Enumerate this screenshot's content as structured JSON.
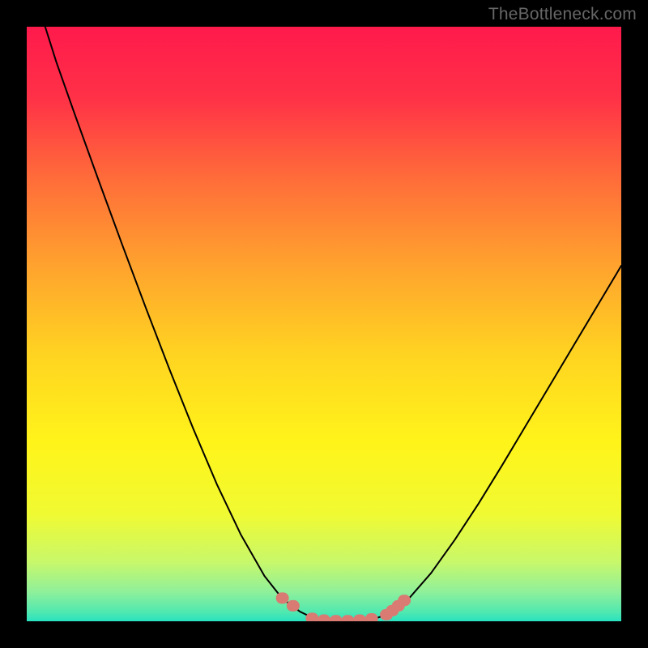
{
  "watermark": "TheBottleneck.com",
  "chart_data": {
    "type": "line",
    "title": "",
    "xlabel": "",
    "ylabel": "",
    "xlim": [
      0,
      100
    ],
    "ylim": [
      0,
      100
    ],
    "grid": false,
    "legend": false,
    "background_gradient": {
      "stops": [
        {
          "offset": 0.0,
          "color": "#ff1a4c"
        },
        {
          "offset": 0.12,
          "color": "#ff3147"
        },
        {
          "offset": 0.25,
          "color": "#ff6a3a"
        },
        {
          "offset": 0.4,
          "color": "#ffa22e"
        },
        {
          "offset": 0.55,
          "color": "#ffd321"
        },
        {
          "offset": 0.7,
          "color": "#fff41a"
        },
        {
          "offset": 0.82,
          "color": "#f0fa32"
        },
        {
          "offset": 0.9,
          "color": "#c8f86a"
        },
        {
          "offset": 0.95,
          "color": "#90f09a"
        },
        {
          "offset": 0.985,
          "color": "#4fe8b0"
        },
        {
          "offset": 1.0,
          "color": "#28e2c0"
        }
      ]
    },
    "series": [
      {
        "name": "bottleneck-curve",
        "stroke": "#000000",
        "stroke_width": 2,
        "x": [
          3.1,
          5,
          8,
          12,
          16,
          20,
          24,
          28,
          32,
          36,
          40,
          43,
          46,
          48.5,
          50,
          52,
          55,
          58,
          60,
          62,
          64,
          68,
          72,
          76,
          80,
          84,
          88,
          92,
          96,
          100
        ],
        "y": [
          100,
          94,
          85.5,
          74.4,
          63.5,
          52.8,
          42.4,
          32.4,
          23.0,
          14.6,
          7.6,
          3.8,
          1.6,
          0.4,
          0,
          0,
          0,
          0.3,
          0.9,
          1.9,
          3.5,
          8.1,
          13.7,
          19.8,
          26.3,
          33.0,
          39.7,
          46.4,
          53.1,
          59.8
        ]
      }
    ],
    "markers": {
      "name": "highlight-segment",
      "color": "#d97b73",
      "points": [
        {
          "x": 43.0,
          "y": 3.9
        },
        {
          "x": 44.8,
          "y": 2.6
        },
        {
          "x": 48.0,
          "y": 0.5
        },
        {
          "x": 50.0,
          "y": 0.2
        },
        {
          "x": 52.0,
          "y": 0.1
        },
        {
          "x": 54.0,
          "y": 0.1
        },
        {
          "x": 56.0,
          "y": 0.2
        },
        {
          "x": 58.0,
          "y": 0.4
        },
        {
          "x": 60.5,
          "y": 1.1
        },
        {
          "x": 61.5,
          "y": 1.8
        },
        {
          "x": 62.5,
          "y": 2.6
        },
        {
          "x": 63.5,
          "y": 3.5
        }
      ]
    }
  }
}
